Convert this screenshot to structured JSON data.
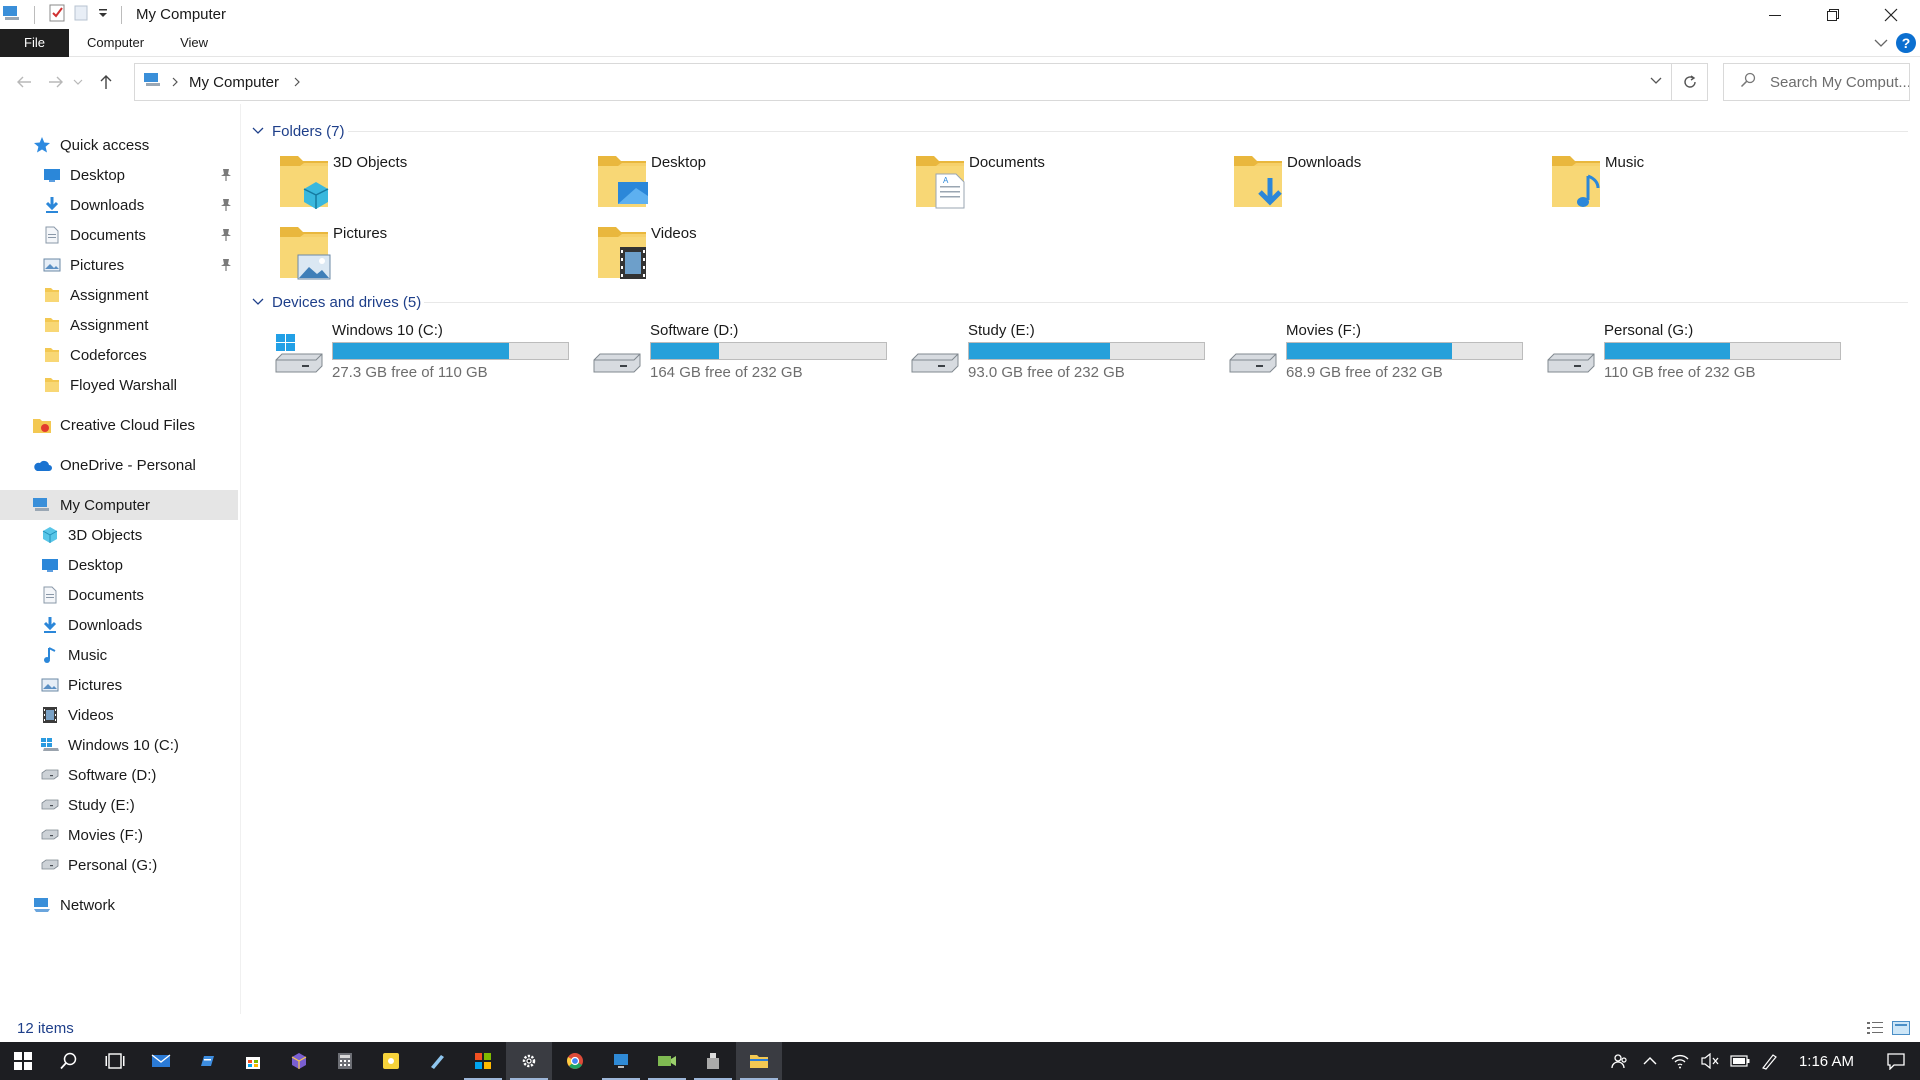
{
  "window": {
    "title": "My Computer"
  },
  "ribbon": {
    "file": "File",
    "tabs": [
      "Computer",
      "View"
    ]
  },
  "address": {
    "crumb": "My Computer"
  },
  "search": {
    "placeholder": "Search My Comput..."
  },
  "sidebar": {
    "quick_access": "Quick access",
    "quick_items": [
      {
        "label": "Desktop",
        "icon": "desktop-icon",
        "pinned": true
      },
      {
        "label": "Downloads",
        "icon": "downloads-icon",
        "pinned": true
      },
      {
        "label": "Documents",
        "icon": "documents-icon",
        "pinned": true
      },
      {
        "label": "Pictures",
        "icon": "pictures-icon",
        "pinned": true
      },
      {
        "label": "Assignment",
        "icon": "folder-icon",
        "pinned": false
      },
      {
        "label": "Assignment",
        "icon": "folder-icon",
        "pinned": false
      },
      {
        "label": "Codeforces",
        "icon": "folder-icon",
        "pinned": false
      },
      {
        "label": "Floyed Warshall",
        "icon": "folder-icon",
        "pinned": false
      }
    ],
    "creative_cloud": "Creative Cloud Files",
    "onedrive": "OneDrive - Personal",
    "my_computer": "My Computer",
    "computer_items": [
      {
        "label": "3D Objects",
        "icon": "3d-objects-icon"
      },
      {
        "label": "Desktop",
        "icon": "desktop-icon"
      },
      {
        "label": "Documents",
        "icon": "documents-icon"
      },
      {
        "label": "Downloads",
        "icon": "downloads-icon"
      },
      {
        "label": "Music",
        "icon": "music-icon"
      },
      {
        "label": "Pictures",
        "icon": "pictures-icon"
      },
      {
        "label": "Videos",
        "icon": "videos-icon"
      },
      {
        "label": "Windows 10 (C:)",
        "icon": "windows-drive-icon"
      },
      {
        "label": "Software (D:)",
        "icon": "drive-icon"
      },
      {
        "label": "Study (E:)",
        "icon": "drive-icon"
      },
      {
        "label": "Movies (F:)",
        "icon": "drive-icon"
      },
      {
        "label": "Personal (G:)",
        "icon": "drive-icon"
      }
    ],
    "network": "Network"
  },
  "content": {
    "folders_header": "Folders (7)",
    "folders": [
      {
        "name": "3D Objects",
        "icon": "3d-objects-folder-icon"
      },
      {
        "name": "Desktop",
        "icon": "desktop-folder-icon"
      },
      {
        "name": "Documents",
        "icon": "documents-folder-icon"
      },
      {
        "name": "Downloads",
        "icon": "downloads-folder-icon"
      },
      {
        "name": "Music",
        "icon": "music-folder-icon"
      },
      {
        "name": "Pictures",
        "icon": "pictures-folder-icon"
      },
      {
        "name": "Videos",
        "icon": "videos-folder-icon"
      }
    ],
    "drives_header": "Devices and drives (5)",
    "drives": [
      {
        "name": "Windows 10 (C:)",
        "free": "27.3 GB free of 110 GB",
        "used_fraction": 0.75,
        "icon": "windows-drive-icon"
      },
      {
        "name": "Software (D:)",
        "free": "164 GB free of 232 GB",
        "used_fraction": 0.29,
        "icon": "drive-icon"
      },
      {
        "name": "Study (E:)",
        "free": "93.0 GB free of 232 GB",
        "used_fraction": 0.6,
        "icon": "drive-icon"
      },
      {
        "name": "Movies (F:)",
        "free": "68.9 GB free of 232 GB",
        "used_fraction": 0.7,
        "icon": "drive-icon"
      },
      {
        "name": "Personal (G:)",
        "free": "110 GB free of 232 GB",
        "used_fraction": 0.53,
        "icon": "drive-icon"
      }
    ]
  },
  "status": {
    "count": "12 items"
  },
  "taskbar": {
    "clock": "1:16 AM"
  },
  "colors": {
    "accent": "#26a0da",
    "link": "#1e3f8a",
    "selection": "#e5e5e5",
    "taskbar": "#1d1e22"
  }
}
